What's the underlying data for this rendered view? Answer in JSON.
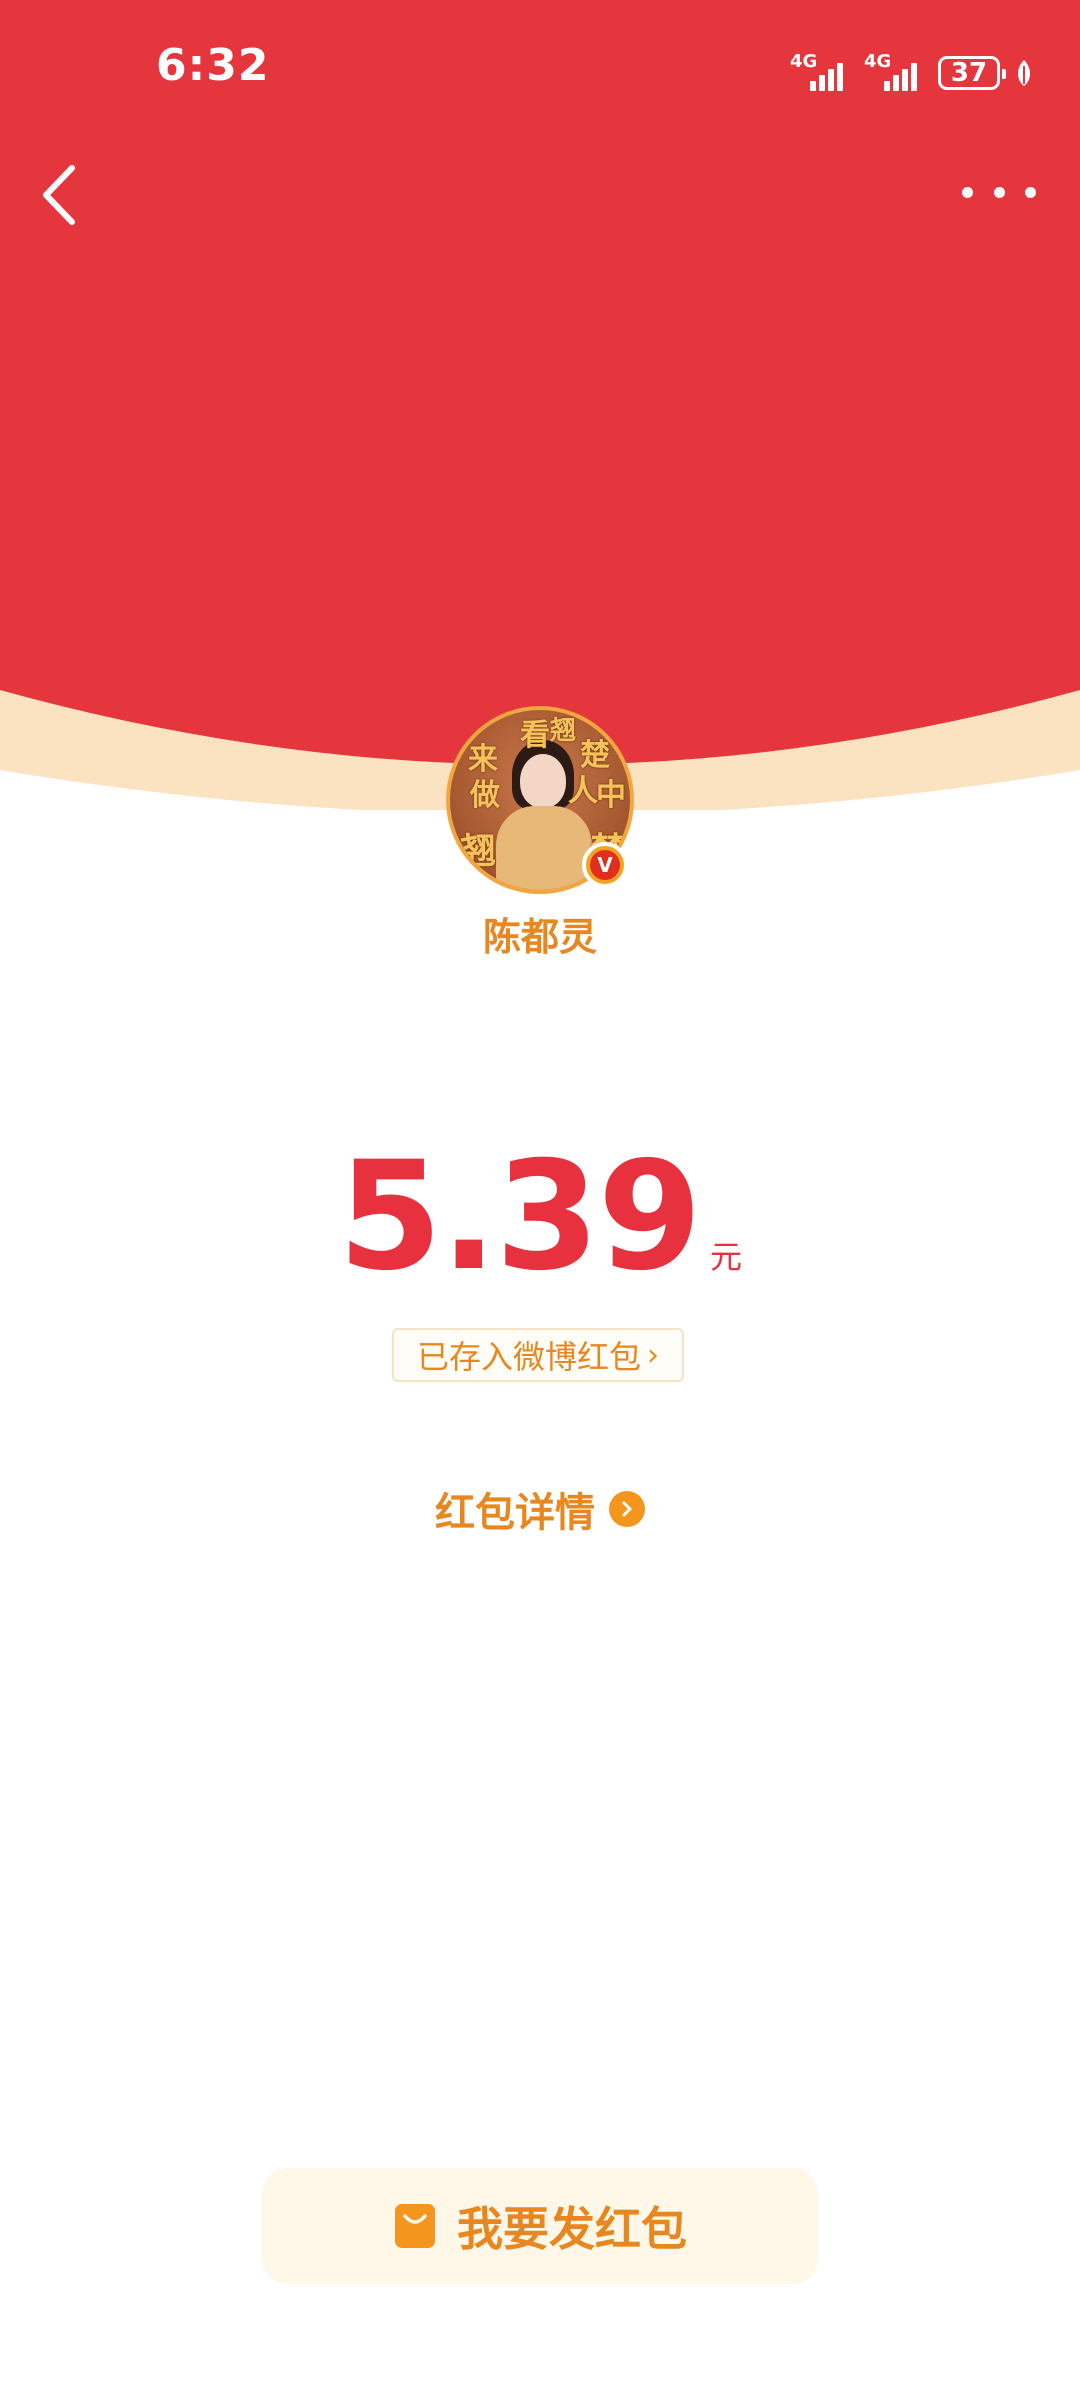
{
  "status_bar": {
    "time": "6:32",
    "signal_1_label": "4G",
    "signal_2_label": "4G",
    "battery_level": "37",
    "icons": [
      "signal-icon",
      "signal-icon",
      "battery-icon",
      "leaf-icon"
    ]
  },
  "nav": {
    "back_icon": "back-chevron-icon",
    "more_icon": "more-dots-icon"
  },
  "sender": {
    "name": "陈都灵",
    "avatar_text": [
      "来",
      "看",
      "翘",
      "楚",
      "做",
      "人",
      "中",
      "翘",
      "楚"
    ],
    "verified_badge": "V"
  },
  "amount": {
    "value": "5.39",
    "unit": "元"
  },
  "saved_link": {
    "label": "已存入微博红包",
    "chevron": "›"
  },
  "detail_link": {
    "label": "红包详情",
    "icon": "arrow-circle-icon"
  },
  "send_button": {
    "label": "我要发红包",
    "icon": "red-packet-bag-icon"
  },
  "colors": {
    "header_red": "#e5353d",
    "accent_orange": "#e8861f",
    "amount_red": "#e8313e",
    "button_bg": "#fff7e8"
  }
}
